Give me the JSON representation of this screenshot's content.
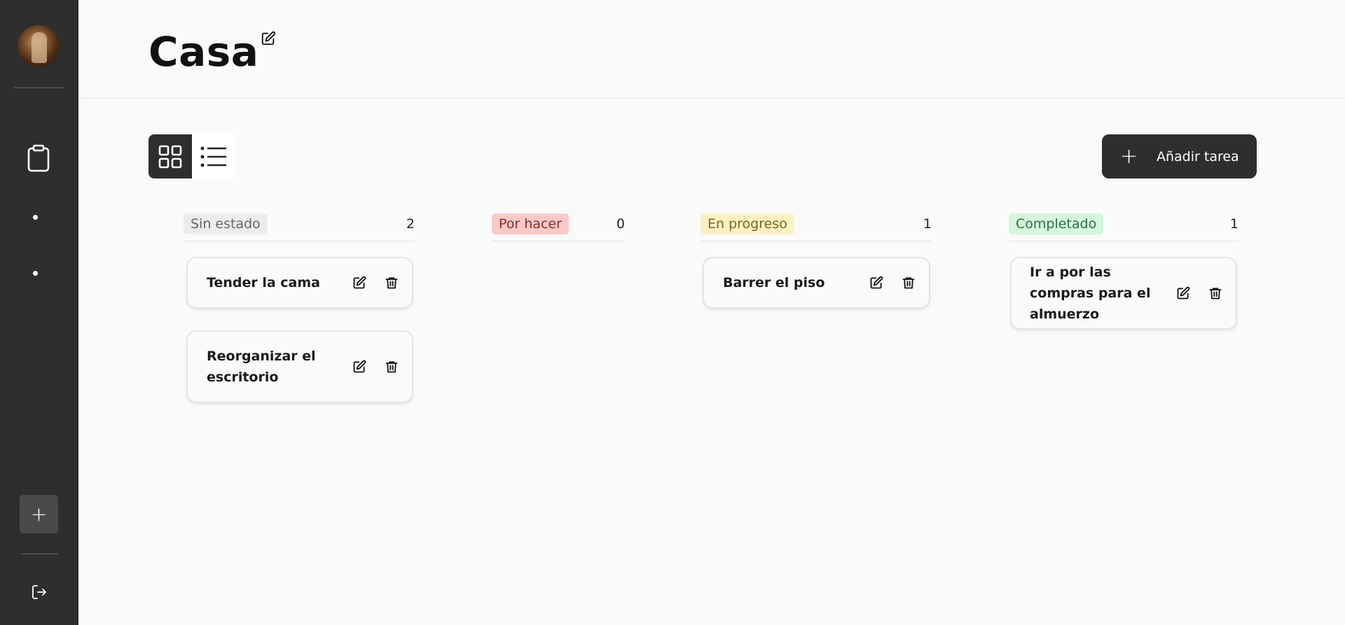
{
  "sidebar": {
    "avatar_alt": "avatar",
    "items": [
      {
        "icon": "clipboard-icon"
      },
      {
        "icon": "dot-icon"
      },
      {
        "icon": "dot-icon"
      }
    ],
    "add_label": "+",
    "logout_icon": "logout-icon"
  },
  "header": {
    "title": "Casa"
  },
  "toolbar": {
    "views": [
      "grid-view",
      "list-view"
    ],
    "active_view": "grid-view",
    "add_task_plus": "+",
    "add_task_label": "Añadir tarea"
  },
  "columns": [
    {
      "label": "Sin estado",
      "count": "2",
      "color": "#ececec",
      "tasks": [
        {
          "title": "Tender la cama"
        },
        {
          "title": "Reorganizar el escritorio"
        }
      ]
    },
    {
      "label": "Por hacer",
      "count": "0",
      "color": "#f9c9c9",
      "tasks": []
    },
    {
      "label": "En progreso",
      "count": "1",
      "color": "#fbf1c3",
      "tasks": [
        {
          "title": "Barrer el piso"
        }
      ]
    },
    {
      "label": "Completado",
      "count": "1",
      "color": "#d6f6dd",
      "tasks": [
        {
          "title": "Ir a por las compras para el almuerzo"
        }
      ]
    }
  ]
}
